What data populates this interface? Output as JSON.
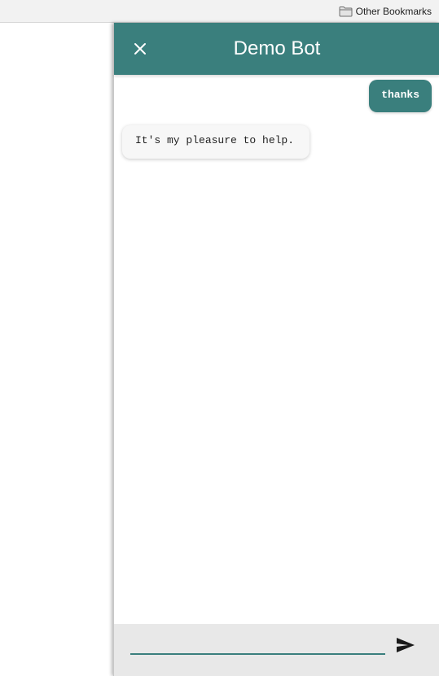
{
  "bookmarks_bar": {
    "folder_label": "Other Bookmarks",
    "folder_icon": "folder-icon"
  },
  "chat": {
    "header": {
      "title": "Demo Bot",
      "close_icon": "close-icon",
      "background_color": "#3a7f7d"
    },
    "messages": [
      {
        "sender": "user",
        "text": "thanks"
      },
      {
        "sender": "bot",
        "text": "It's my pleasure to help."
      }
    ],
    "composer": {
      "input_value": "",
      "send_icon": "send-icon"
    },
    "accent_color": "#3a7f7d",
    "bot_bubble_color": "#f7f7f7",
    "composer_background_color": "#e8e8e8"
  }
}
